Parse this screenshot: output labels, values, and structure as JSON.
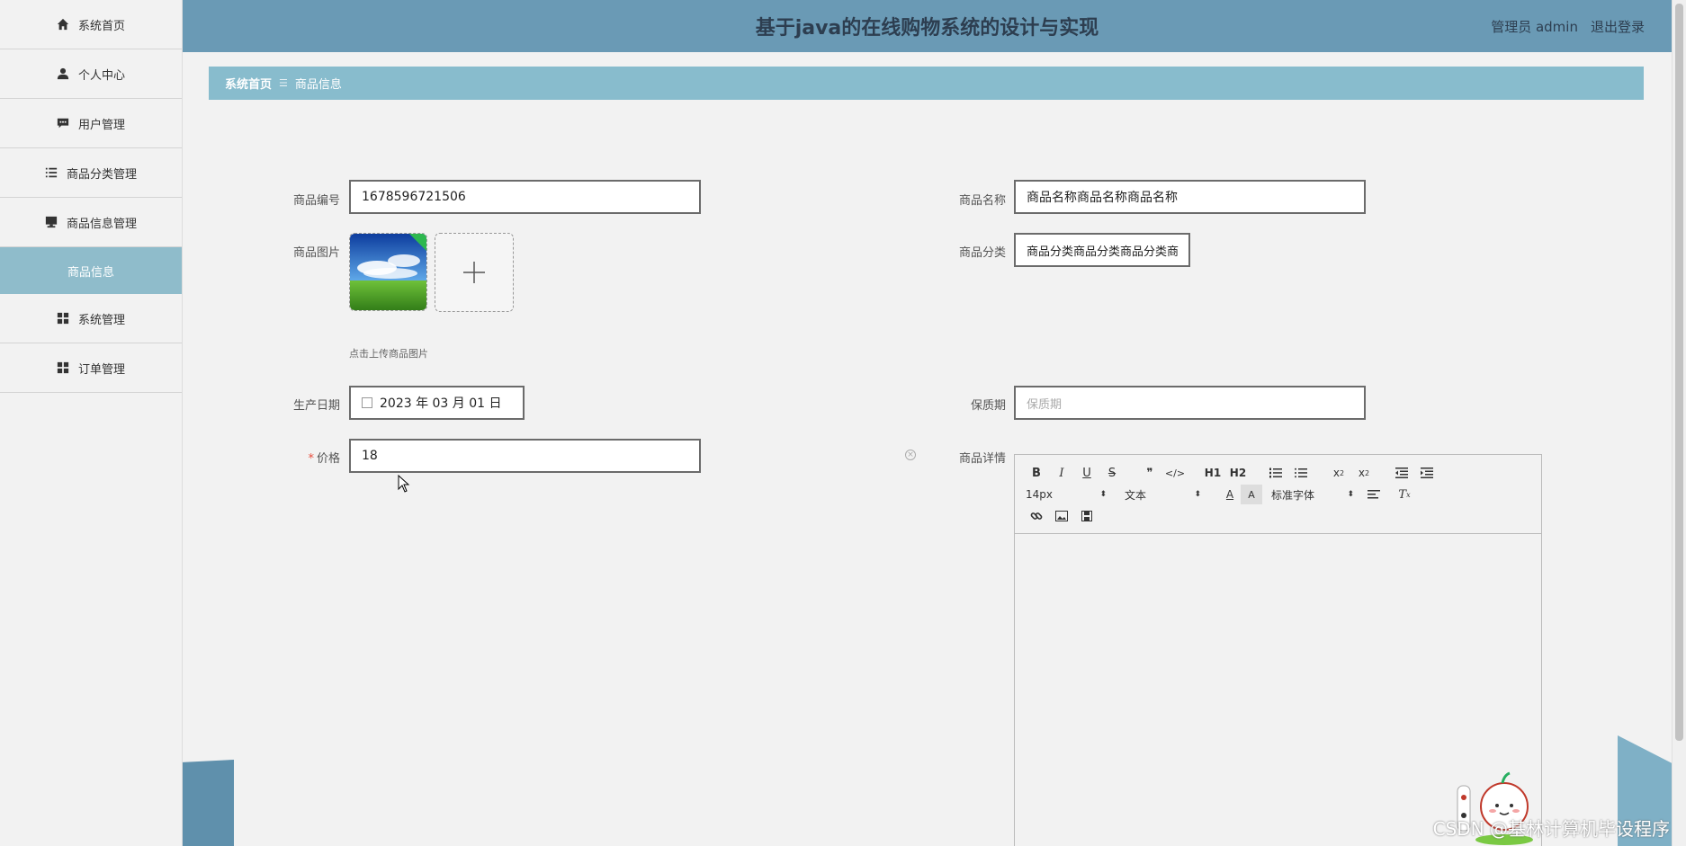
{
  "sidebar": {
    "items": [
      {
        "label": "系统首页",
        "icon": "home-icon"
      },
      {
        "label": "个人中心",
        "icon": "user-icon"
      },
      {
        "label": "用户管理",
        "icon": "chat-icon"
      },
      {
        "label": "商品分类管理",
        "icon": "list-icon"
      },
      {
        "label": "商品信息管理",
        "icon": "monitor-icon"
      },
      {
        "label": "商品信息",
        "active": true
      },
      {
        "label": "系统管理",
        "icon": "grid-icon"
      },
      {
        "label": "订单管理",
        "icon": "grid-icon"
      }
    ]
  },
  "header": {
    "title": "基于java的在线购物系统的设计与实现",
    "user_label": "管理员 admin",
    "logout": "退出登录"
  },
  "breadcrumb": {
    "home": "系统首页",
    "sep": "☰",
    "current": "商品信息"
  },
  "form": {
    "code_label": "商品编号",
    "code_value": "1678596721506",
    "name_label": "商品名称",
    "name_value": "商品名称商品名称商品名称",
    "image_label": "商品图片",
    "image_hint": "点击上传商品图片",
    "category_label": "商品分类",
    "category_value": "商品分类商品分类商品分类商",
    "date_label": "生产日期",
    "date_value": "2023 年 03 月 01 日",
    "shelf_label": "保质期",
    "shelf_placeholder": "保质期",
    "price_req": "*",
    "price_label": "价格",
    "price_value": "18",
    "detail_label": "商品详情"
  },
  "editor": {
    "font_size": "14px",
    "block_type": "文本",
    "font_family": "标准字体",
    "buttons": [
      "B",
      "I",
      "U",
      "S",
      "❞",
      "</>",
      "H1",
      "H2"
    ]
  },
  "watermark": "CSDN @基林计算机毕设程序",
  "colors": {
    "header_bg": "#6a9ab5",
    "breadcrumb_bg": "#88bccd",
    "active_menu_bg": "#8fbccb"
  }
}
